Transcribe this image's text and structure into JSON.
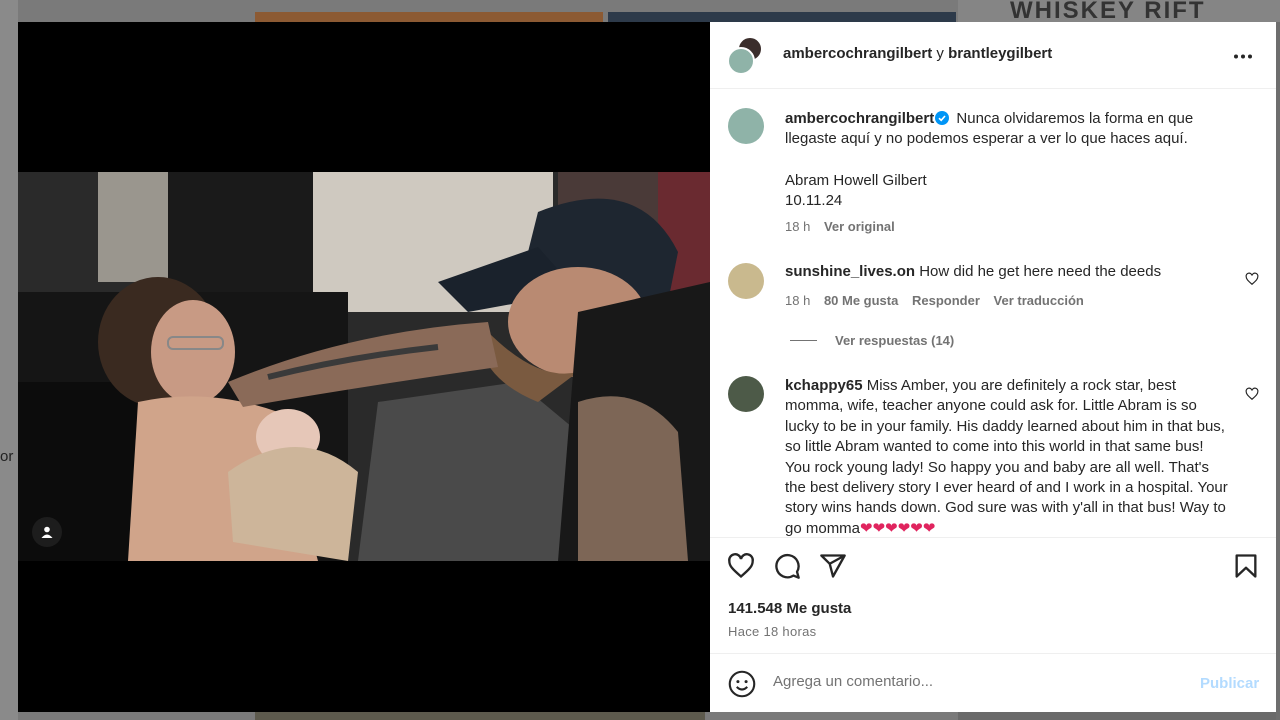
{
  "background": {
    "left_text": "or",
    "top_right_text": "WHISKEY RIFT"
  },
  "header": {
    "user1": "ambercochrangilbert",
    "connector": "y",
    "user2": "brantleygilbert"
  },
  "caption": {
    "username": "ambercochrangilbert",
    "text": "Nunca olvidaremos la forma en que llegaste aquí y no podemos esperar a ver lo que haces aquí.",
    "name_line": "Abram Howell Gilbert",
    "date_line": "10.11.24",
    "time": "18 h",
    "see_original": "Ver original"
  },
  "comments": [
    {
      "username": "sunshine_lives.on",
      "text": "How did he get here need the deeds",
      "time": "18 h",
      "likes": "80 Me gusta",
      "reply": "Responder",
      "translate": "Ver traducción",
      "view_replies": "Ver respuestas (14)"
    },
    {
      "username": "kchappy65",
      "text": "Miss Amber, you are definitely a rock star, best momma, wife, teacher anyone could ask for. Little Abram is so lucky to be in your family. His daddy learned about him in that bus, so little Abram wanted to come into this world in that same bus! You rock young lady! So happy you and baby are all well. That's the best delivery story I ever heard of and I work in a hospital. Your story wins hands down. God sure was with y'all in that bus! Way to go momma",
      "hearts": "❤❤❤❤❤❤"
    }
  ],
  "stats": {
    "likes": "141.548 Me gusta",
    "time": "Hace 18 horas"
  },
  "composer": {
    "placeholder": "Agrega un comentario...",
    "post_label": "Publicar"
  },
  "icons": {
    "more": "more-options-icon",
    "like": "heart-icon",
    "comment": "comment-icon",
    "share": "share-icon",
    "save": "bookmark-icon",
    "emoji": "emoji-icon",
    "user_tag": "user-tag-icon",
    "verified": "verified-badge-icon"
  },
  "colors": {
    "verified": "#0095f6",
    "post_disabled": "#b3dbff",
    "heart_red": "#e0245e"
  }
}
